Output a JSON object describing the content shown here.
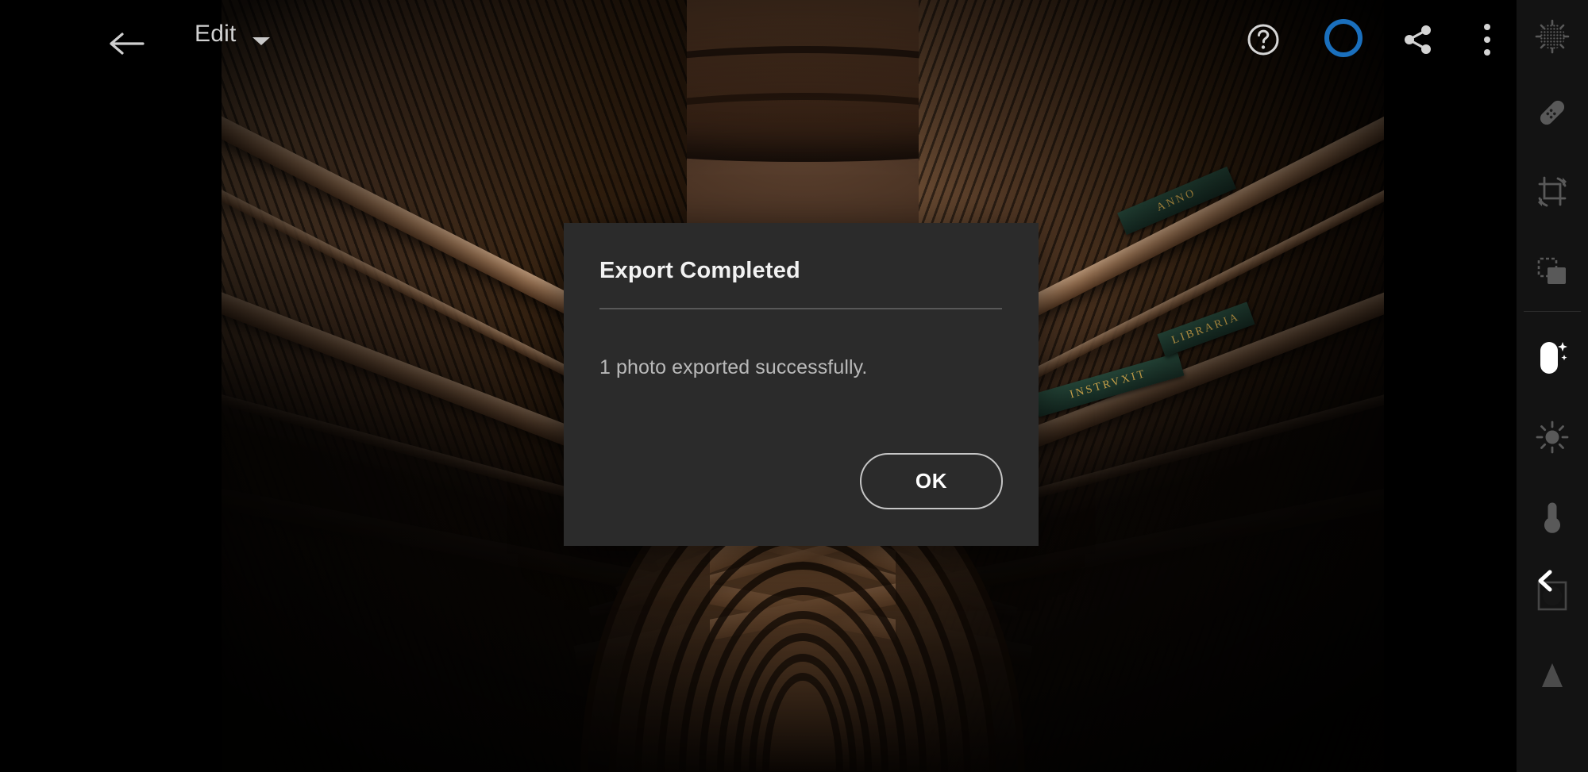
{
  "app": {
    "mode_label": "Edit",
    "background_color": "#000000",
    "panel_color": "#131313",
    "dialog_color": "#2b2b2b",
    "accent_color": "#1a6fbd"
  },
  "topbar": {
    "back_icon": "arrow-left-icon",
    "mode_label": "Edit",
    "mode_caret_icon": "caret-down-icon",
    "help_icon": "help-circle-icon",
    "sync_icon": "sync-status-ring",
    "share_icon": "share-icon",
    "more_icon": "more-vertical-icon"
  },
  "rail": {
    "items": [
      {
        "name": "selective-masking",
        "icon": "halftone-circle-icon",
        "active": false
      },
      {
        "name": "healing-brush",
        "icon": "bandage-icon",
        "active": false
      },
      {
        "name": "crop",
        "icon": "crop-rotate-icon",
        "active": false
      },
      {
        "name": "presets",
        "icon": "layers-icon",
        "active": false
      },
      {
        "name": "auto",
        "icon": "auto-pill-sparkle-icon",
        "active": true
      },
      {
        "name": "light",
        "icon": "sun-icon",
        "active": false
      },
      {
        "name": "color",
        "icon": "thermometer-icon",
        "active": false
      },
      {
        "name": "effects",
        "icon": "circle-in-square-icon",
        "active": false
      },
      {
        "name": "detail",
        "icon": "triangle-icon",
        "active": false
      }
    ],
    "collapse_icon": "chevron-left-icon"
  },
  "dialog": {
    "title": "Export Completed",
    "message": "1 photo exported successfully.",
    "ok_label": "OK"
  },
  "photo": {
    "alt": "Long Room library interior with barrel-vaulted wooden ceiling and tall bookshelves receding in perspective"
  }
}
